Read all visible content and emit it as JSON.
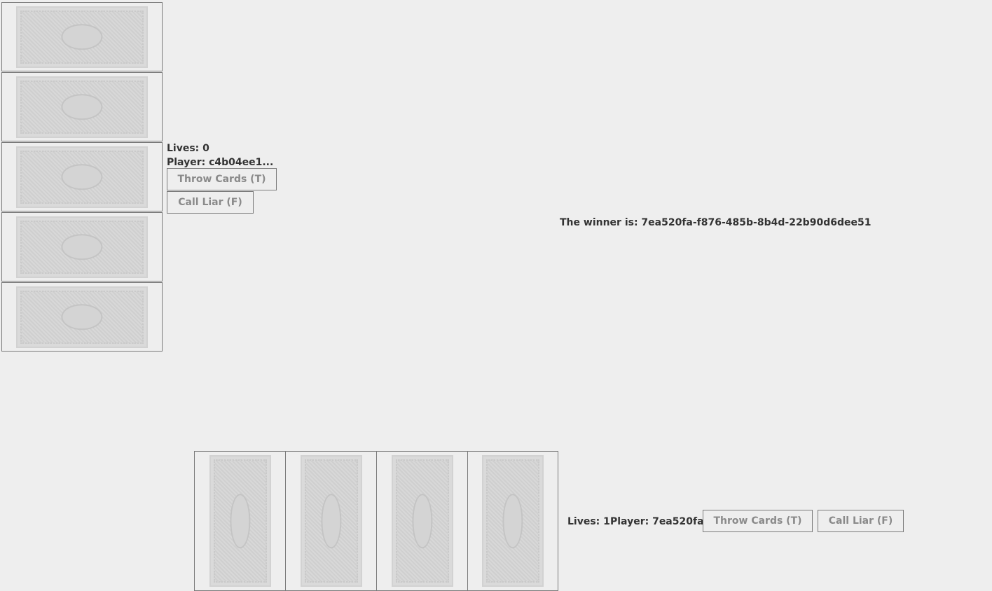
{
  "opponent": {
    "lives": "Lives: 0",
    "player": "Player: c4b04ee1...",
    "throw_button": "Throw Cards (T)",
    "liar_button": "Call Liar (F)",
    "card_count": 5
  },
  "status": {
    "winner": "The winner is: 7ea520fa-f876-485b-8b4d-22b90d6dee51"
  },
  "self": {
    "lives": "Lives: 1",
    "player": "Player: 7ea520fa...",
    "throw_button": "Throw Cards (T)",
    "liar_button": "Call Liar (F)",
    "card_count": 4
  }
}
